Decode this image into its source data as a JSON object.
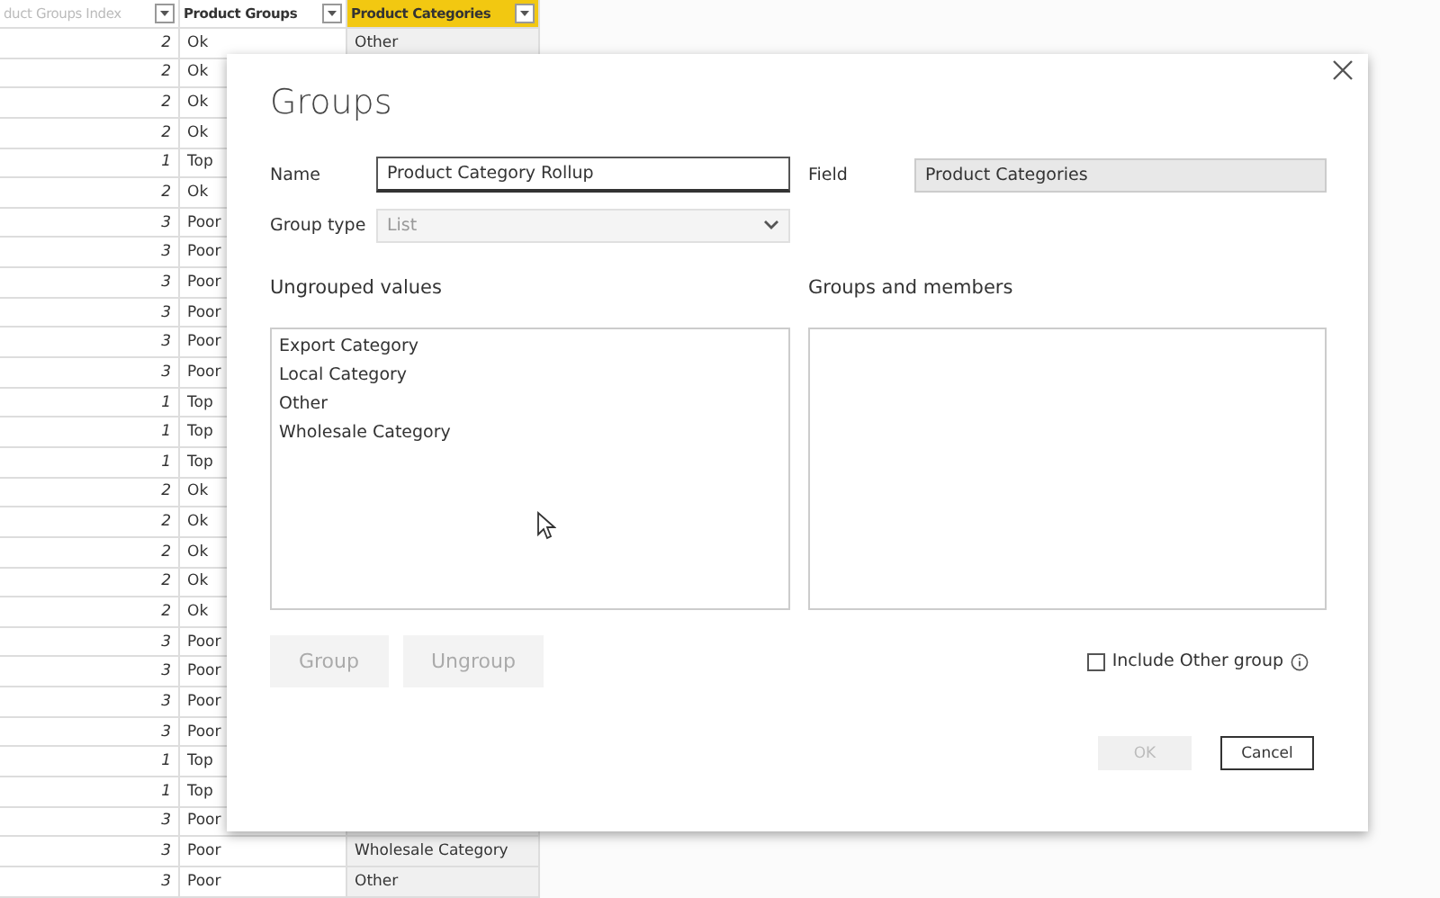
{
  "table": {
    "columns": [
      {
        "label": "duct Groups Index",
        "selected": false
      },
      {
        "label": "Product Groups",
        "selected": false
      },
      {
        "label": "Product Categories",
        "selected": true
      }
    ],
    "rows": [
      {
        "index": "2",
        "group": "Ok",
        "category": "Other"
      },
      {
        "index": "2",
        "group": "Ok"
      },
      {
        "index": "2",
        "group": "Ok"
      },
      {
        "index": "2",
        "group": "Ok"
      },
      {
        "index": "1",
        "group": "Top"
      },
      {
        "index": "2",
        "group": "Ok"
      },
      {
        "index": "3",
        "group": "Poor"
      },
      {
        "index": "3",
        "group": "Poor"
      },
      {
        "index": "3",
        "group": "Poor"
      },
      {
        "index": "3",
        "group": "Poor"
      },
      {
        "index": "3",
        "group": "Poor"
      },
      {
        "index": "3",
        "group": "Poor"
      },
      {
        "index": "1",
        "group": "Top"
      },
      {
        "index": "1",
        "group": "Top"
      },
      {
        "index": "1",
        "group": "Top"
      },
      {
        "index": "2",
        "group": "Ok"
      },
      {
        "index": "2",
        "group": "Ok"
      },
      {
        "index": "2",
        "group": "Ok"
      },
      {
        "index": "2",
        "group": "Ok"
      },
      {
        "index": "2",
        "group": "Ok"
      },
      {
        "index": "3",
        "group": "Poor"
      },
      {
        "index": "3",
        "group": "Poor"
      },
      {
        "index": "3",
        "group": "Poor"
      },
      {
        "index": "3",
        "group": "Poor"
      },
      {
        "index": "1",
        "group": "Top"
      },
      {
        "index": "1",
        "group": "Top"
      },
      {
        "index": "3",
        "group": "Poor"
      },
      {
        "index": "3",
        "group": "Poor",
        "category": "Wholesale Category"
      },
      {
        "index": "3",
        "group": "Poor",
        "category": "Other"
      }
    ]
  },
  "dialog": {
    "title": "Groups",
    "name_label": "Name",
    "name_value": "Product Category Rollup",
    "field_label": "Field",
    "field_value": "Product Categories",
    "group_type_label": "Group type",
    "group_type_value": "List",
    "ungrouped_heading": "Ungrouped values",
    "ungrouped_items": [
      "Export Category",
      "Local Category",
      "Other",
      "Wholesale Category"
    ],
    "groups_heading": "Groups and members",
    "group_buttons": [
      {
        "label": "Group",
        "disabled": true
      },
      {
        "label": "Ungroup",
        "disabled": true
      }
    ],
    "include_other": {
      "label": "Include Other group",
      "checked": false
    },
    "footer_buttons": [
      {
        "label": "OK",
        "disabled": true
      },
      {
        "label": "Cancel",
        "disabled": false
      }
    ]
  }
}
